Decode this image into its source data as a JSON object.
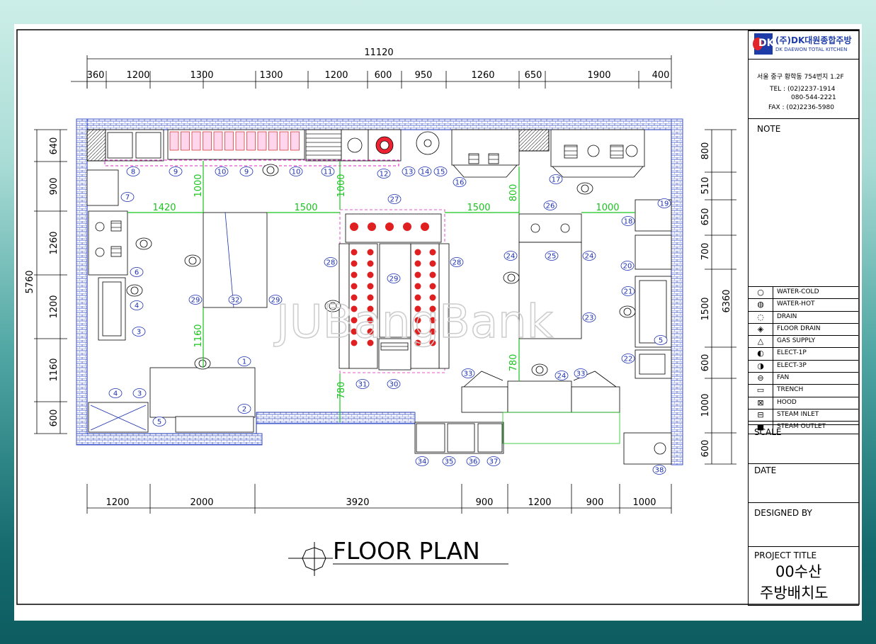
{
  "company": {
    "name": "(주)DK대원종합주방",
    "subname": "DK DAEWON TOTAL KITCHEN",
    "address": "서울 중구 황학동 754번지 1.2F",
    "tel1": "TEL : (02)2237-1914",
    "tel2": "080-544-2221",
    "fax": "FAX : (02)2236-5980",
    "logo": "DK"
  },
  "titleblock": {
    "note": "NOTE",
    "scale": "SCALE",
    "date": "DATE",
    "designed_by": "DESIGNED BY",
    "project_title": "PROJECT TITLE",
    "project_line1": "00수산",
    "project_line2": "주방배치도"
  },
  "legend": [
    {
      "icon": "water-cold",
      "label": "WATER-COLD"
    },
    {
      "icon": "water-hot",
      "label": "WATER-HOT"
    },
    {
      "icon": "drain",
      "label": "DRAIN"
    },
    {
      "icon": "floor-drain",
      "label": "FLOOR DRAIN"
    },
    {
      "icon": "gas-supply",
      "label": "GAS SUPPLY"
    },
    {
      "icon": "elect-1p",
      "label": "ELECT-1P"
    },
    {
      "icon": "elect-3p",
      "label": "ELECT-3P"
    },
    {
      "icon": "fan",
      "label": "FAN"
    },
    {
      "icon": "trench",
      "label": "TRENCH"
    },
    {
      "icon": "hood",
      "label": "HOOD"
    },
    {
      "icon": "steam-inlet",
      "label": "STEAM INLET"
    },
    {
      "icon": "steam-outlet",
      "label": "STEAM OUTLET"
    }
  ],
  "drawing": {
    "title": "FLOOR PLAN",
    "watermark": "JUBangBank",
    "overall_width": "11120",
    "top_dims": [
      "360",
      "1200",
      "1300",
      "1300",
      "1200",
      "600",
      "950",
      "1260",
      "650",
      "1900",
      "400"
    ],
    "bottom_dims": [
      "1200",
      "2000",
      "3920",
      "900",
      "1200",
      "900",
      "1000"
    ],
    "left_overall": "5760",
    "left_dims": [
      "640",
      "900",
      "1260",
      "1200",
      "1160",
      "600"
    ],
    "right_overall": "6360",
    "right_dims": [
      "800",
      "510",
      "650",
      "700",
      "1500",
      "600",
      "1000",
      "600"
    ],
    "green_dims": [
      "1420",
      "1500",
      "1500",
      "1000",
      "1000",
      "1000",
      "800",
      "1160",
      "780",
      "780"
    ],
    "item_numbers": [
      "1",
      "2",
      "3",
      "3",
      "4",
      "4",
      "5",
      "5",
      "6",
      "7",
      "8",
      "9",
      "9",
      "10",
      "10",
      "11",
      "12",
      "13",
      "14",
      "15",
      "16",
      "17",
      "18",
      "19",
      "20",
      "21",
      "22",
      "23",
      "24",
      "24",
      "24",
      "25",
      "26",
      "27",
      "28",
      "28",
      "29",
      "29",
      "29",
      "30",
      "31",
      "32",
      "33",
      "33",
      "34",
      "35",
      "36",
      "37",
      "38"
    ]
  }
}
